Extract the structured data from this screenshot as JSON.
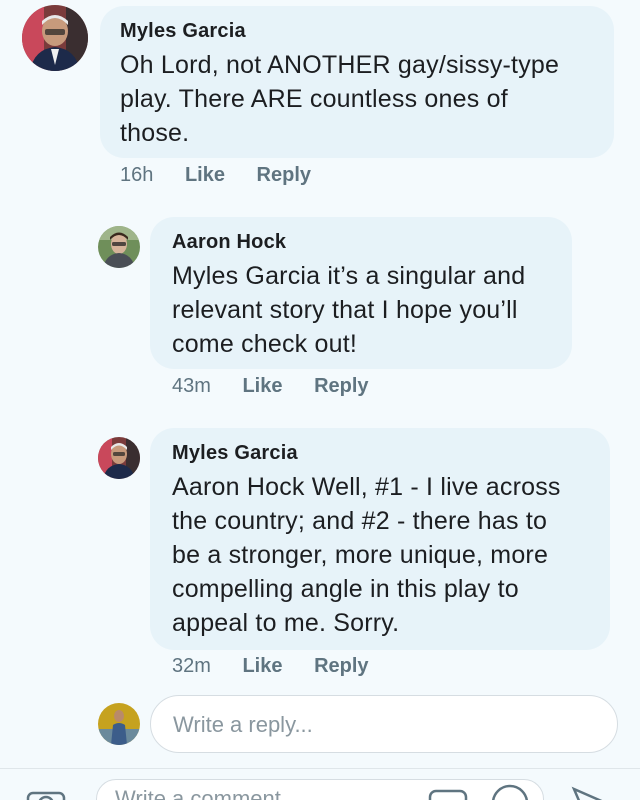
{
  "comments": [
    {
      "author": "Myles Garcia",
      "text": "Oh Lord, not ANOTHER gay/sissy-type\nplay.  There ARE countless ones of\nthose.",
      "time": "16h",
      "like_label": "Like",
      "reply_label": "Reply",
      "avatar_icon": "profile-photo-myles"
    },
    {
      "author": "Aaron Hock",
      "text": "Myles Garcia it’s a singular and\nrelevant story that I hope you’ll\ncome check out!",
      "time": "43m",
      "like_label": "Like",
      "reply_label": "Reply",
      "avatar_icon": "profile-photo-aaron"
    },
    {
      "author": "Myles Garcia",
      "text": "Aaron Hock Well, #1 - I live across\nthe country; and #2 - there has to\nbe a stronger, more unique, more\ncompelling angle in this play to\nappeal to me.  Sorry.",
      "time": "32m",
      "like_label": "Like",
      "reply_label": "Reply",
      "avatar_icon": "profile-photo-myles"
    }
  ],
  "reply_box": {
    "placeholder": "Write a reply...",
    "avatar_icon": "profile-photo-current-user"
  },
  "bottom_bar": {
    "placeholder": "Write a comment...",
    "icons": [
      "camera-icon",
      "gif-icon",
      "emoji-icon",
      "send-icon"
    ]
  },
  "colors": {
    "background": "#f4fafd",
    "bubble": "#e7f3f9",
    "meta_text": "#5f7480"
  }
}
